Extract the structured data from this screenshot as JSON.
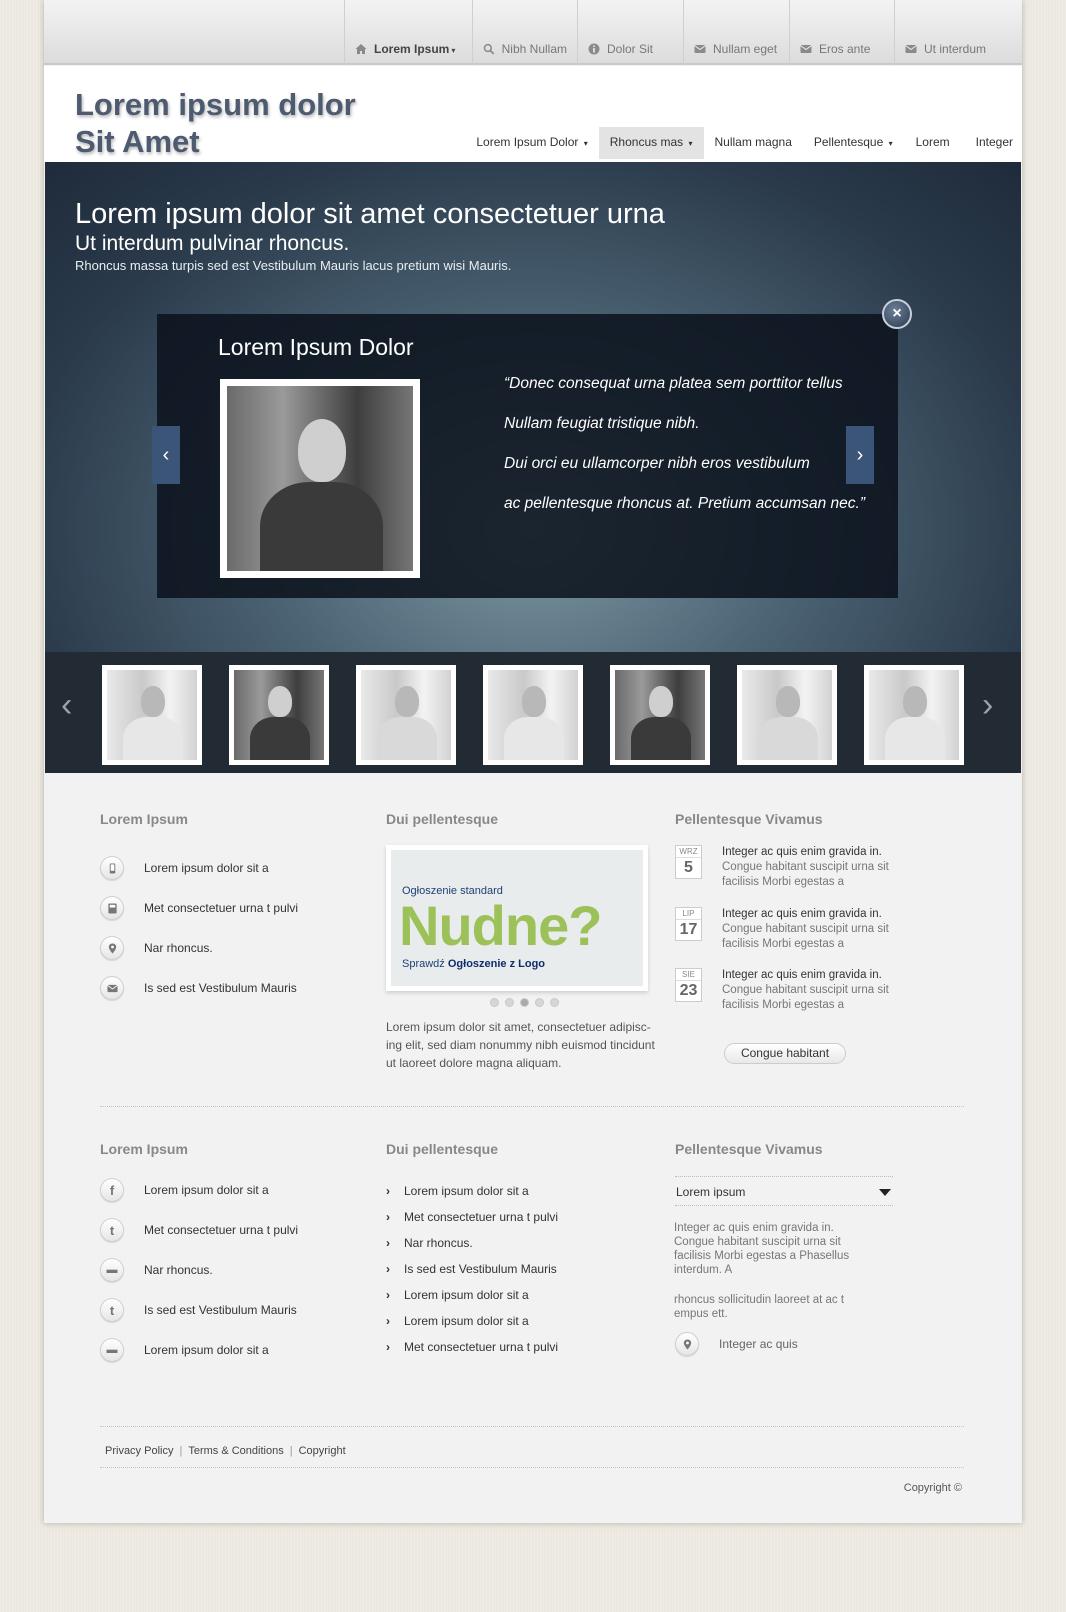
{
  "top_nav": [
    {
      "label": "Lorem Ipsum",
      "icon": "home-icon",
      "caret": "▾"
    },
    {
      "label": "Nibh Nullam",
      "icon": "search-icon"
    },
    {
      "label": "Dolor Sit",
      "icon": "info-icon"
    },
    {
      "label": "Nullam eget",
      "icon": "mail-icon"
    },
    {
      "label": "Eros ante",
      "icon": "mail-icon"
    },
    {
      "label": "Ut interdum",
      "icon": "mail-icon"
    }
  ],
  "logo": {
    "line1": "Lorem ipsum dolor",
    "line2": "Sit Amet"
  },
  "main_nav": [
    {
      "label": "Lorem Ipsum Dolor",
      "caret": "▾"
    },
    {
      "label": "Rhoncus mas",
      "caret": "▾",
      "active": true
    },
    {
      "label": "Nullam magna"
    },
    {
      "label": "Pellentesque",
      "caret": "▾"
    },
    {
      "label": "Lorem"
    },
    {
      "label": "Integer"
    }
  ],
  "hero": {
    "title": "Lorem ipsum dolor sit amet consectetuer urna",
    "subtitle": "Ut interdum pulvinar rhoncus.",
    "text": "Rhoncus massa turpis sed est Vestibulum Mauris lacus pretium wisi Mauris."
  },
  "slide": {
    "name": "Lorem Ipsum Dolor",
    "quote_lines": [
      "“Donec consequat urna platea sem porttitor tellus",
      "Nullam feugiat tristique nibh.",
      "Dui orci eu ullamcorper nibh eros vestibulum",
      "ac pellentesque rhoncus at. Pretium accumsan nec.”"
    ],
    "prev": "‹",
    "next": "›",
    "close": "×"
  },
  "thumb_strip": {
    "prev": "‹",
    "next": "›",
    "thumbs": [
      "light",
      "dark",
      "face",
      "light",
      "dark",
      "face",
      "light"
    ]
  },
  "section1": {
    "col1": {
      "title": "Lorem Ipsum",
      "items": [
        {
          "icon": "phone-icon",
          "label": "Lorem ipsum dolor sit a"
        },
        {
          "icon": "fax-icon",
          "label": "Met consectetuer urna t pulvi"
        },
        {
          "icon": "map-pin-icon",
          "label": "Nar rhoncus."
        },
        {
          "icon": "mail-icon",
          "label": "Is sed est Vestibulum Mauris"
        }
      ]
    },
    "col2": {
      "title": "Dui pellentesque",
      "ad": {
        "small": "Ogłoszenie standard",
        "big": "Nudne?",
        "bottom_prefix": "Sprawdź ",
        "bottom_bold": "Ogłoszenie z Logo"
      },
      "slider_dots": 5,
      "active_dot": 3,
      "text": "Lorem ipsum dolor sit amet, consectetuer adipisc­ing elit, sed diam nonummy nibh euismod tinci­dunt ut laoreet dolore magna aliquam."
    },
    "col3": {
      "title": "Pellentesque Vivamus",
      "news": [
        {
          "month": "WRZ",
          "day": "5",
          "title": "Integer ac quis enim gravida in.",
          "text": "Congue habitant suscipit urna sit facilisis Morbi egestas a"
        },
        {
          "month": "LIP",
          "day": "17",
          "title": "Integer ac quis enim gravida in.",
          "text": "Congue habitant suscipit urna sit facilisis Morbi egestas a"
        },
        {
          "month": "SIE",
          "day": "23",
          "title": "Integer ac quis enim gravida in.",
          "text": "Congue habitant suscipit urna sit facilisis Morbi egestas a"
        }
      ],
      "button": "Congue habitant"
    }
  },
  "section2": {
    "col1": {
      "title": "Lorem Ipsum",
      "items": [
        {
          "icon": "facebook-icon",
          "glyph": "f",
          "label": "Lorem ipsum dolor sit a"
        },
        {
          "icon": "twitter-icon",
          "glyph": "t",
          "label": "Met consectetuer urna t pulvi"
        },
        {
          "icon": "youtube-icon",
          "glyph": "▬",
          "label": "Nar rhoncus."
        },
        {
          "icon": "twitter-icon",
          "glyph": "t",
          "label": "Is sed est Vestibulum Mauris"
        },
        {
          "icon": "youtube-icon",
          "glyph": "▬",
          "label": "Lorem ipsum dolor sit a"
        }
      ]
    },
    "col2": {
      "title": "Dui pellentesque",
      "chevron": "›",
      "links": [
        "Lorem ipsum dolor sit a",
        "Met consectetuer urna t pulvi",
        "Nar rhoncus.",
        "Is sed est Vestibulum Mauris",
        "Lorem ipsum dolor sit a",
        "Lorem ipsum dolor sit a",
        "Met consectetuer urna t pulvi"
      ]
    },
    "col3": {
      "title": "Pellentesque Vivamus",
      "select_value": "Lorem ipsum",
      "para1": "Integer ac quis enim gravida in. Congue habitant suscipit urna sit facilisis Morbi egestas a Phasellus interdum. A",
      "para2": "rhoncus sollicitudin laoreet at ac t empus ett.",
      "location": "Integer ac quis"
    }
  },
  "footer": {
    "links": [
      "Privacy Policy",
      "Terms & Conditions",
      "Copyright"
    ],
    "separator": "|",
    "copyright": "Copyright ©"
  }
}
